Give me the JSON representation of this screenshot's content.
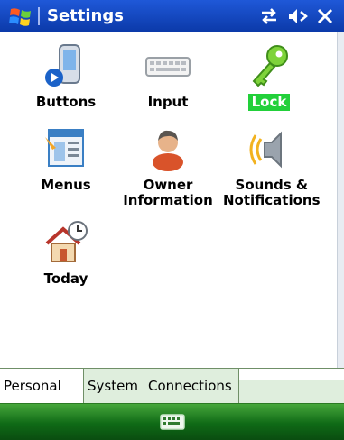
{
  "window": {
    "title": "Settings"
  },
  "colors": {
    "titlebar": "#1f58d8",
    "selection": "#22d03a",
    "bottombar": "#2b8a2a"
  },
  "items": [
    {
      "label": "Buttons",
      "icon": "device-buttons-icon",
      "selected": false
    },
    {
      "label": "Input",
      "icon": "keyboard-icon",
      "selected": false
    },
    {
      "label": "Lock",
      "icon": "key-icon",
      "selected": true
    },
    {
      "label": "Menus",
      "icon": "menus-icon",
      "selected": false
    },
    {
      "label": "Owner Information",
      "icon": "owner-icon",
      "selected": false
    },
    {
      "label": "Sounds & Notifications",
      "icon": "speaker-icon",
      "selected": false
    },
    {
      "label": "Today",
      "icon": "home-clock-icon",
      "selected": false
    }
  ],
  "tabs": [
    {
      "label": "Personal",
      "active": true
    },
    {
      "label": "System",
      "active": false
    },
    {
      "label": "Connections",
      "active": false
    }
  ],
  "bottombar": {
    "input_icon": "keyboard-icon"
  }
}
